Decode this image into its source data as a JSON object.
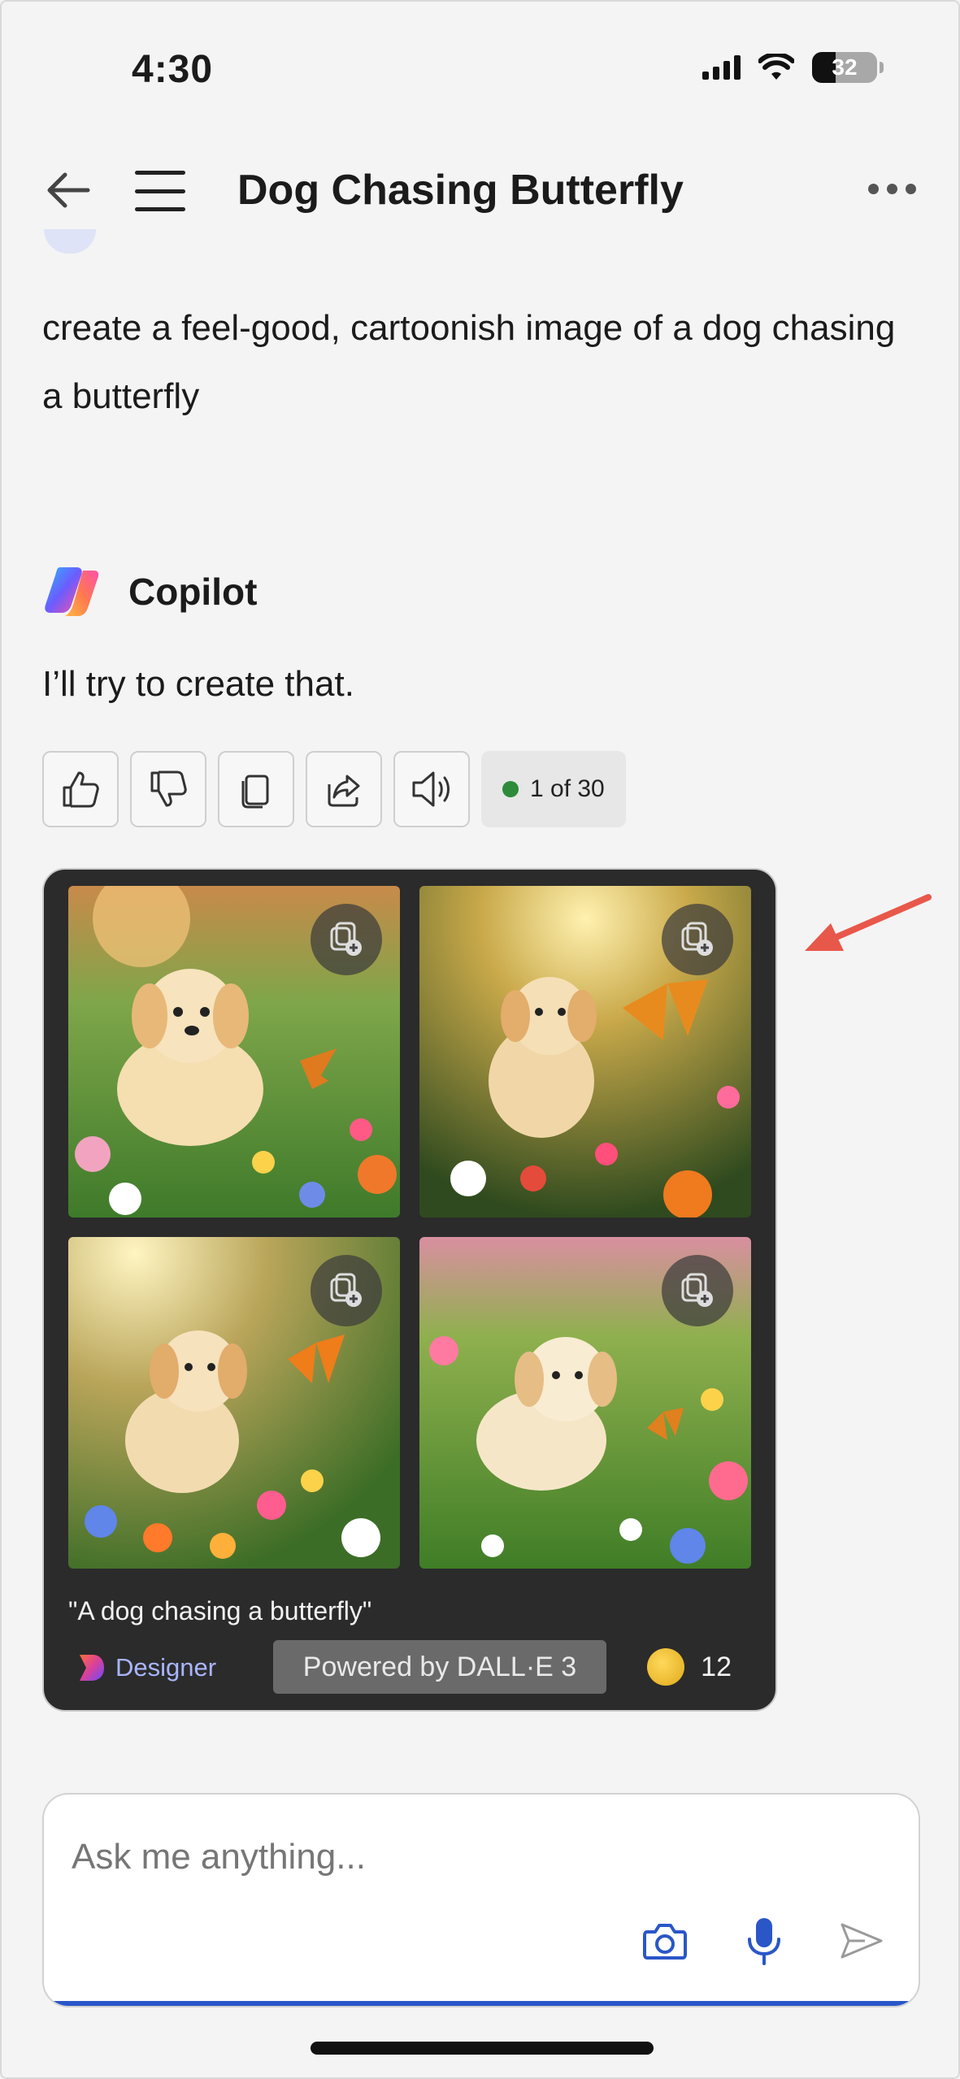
{
  "status_bar": {
    "time": "4:30",
    "battery_level": "32"
  },
  "header": {
    "title": "Dog Chasing Butterfly"
  },
  "conversation": {
    "user_message": "create a feel-good, cartoonish image of a dog chasing a butterfly",
    "assistant_name": "Copilot",
    "assistant_reply": "I’ll try to create that.",
    "response_counter": "1 of 30"
  },
  "image_card": {
    "images": [
      {
        "icon": "add-to-collection-icon"
      },
      {
        "icon": "add-to-collection-icon"
      },
      {
        "icon": "add-to-collection-icon"
      },
      {
        "icon": "add-to-collection-icon"
      }
    ],
    "caption": "\"A dog chasing a butterfly\"",
    "designer_label": "Designer",
    "powered_by": "Powered by DALL·E 3",
    "boost_count": "12"
  },
  "composer": {
    "placeholder": "Ask me anything..."
  },
  "colors": {
    "accent": "#2a56c8",
    "card_bg": "#2b2b2b",
    "annotation_arrow": "#e8584a"
  }
}
